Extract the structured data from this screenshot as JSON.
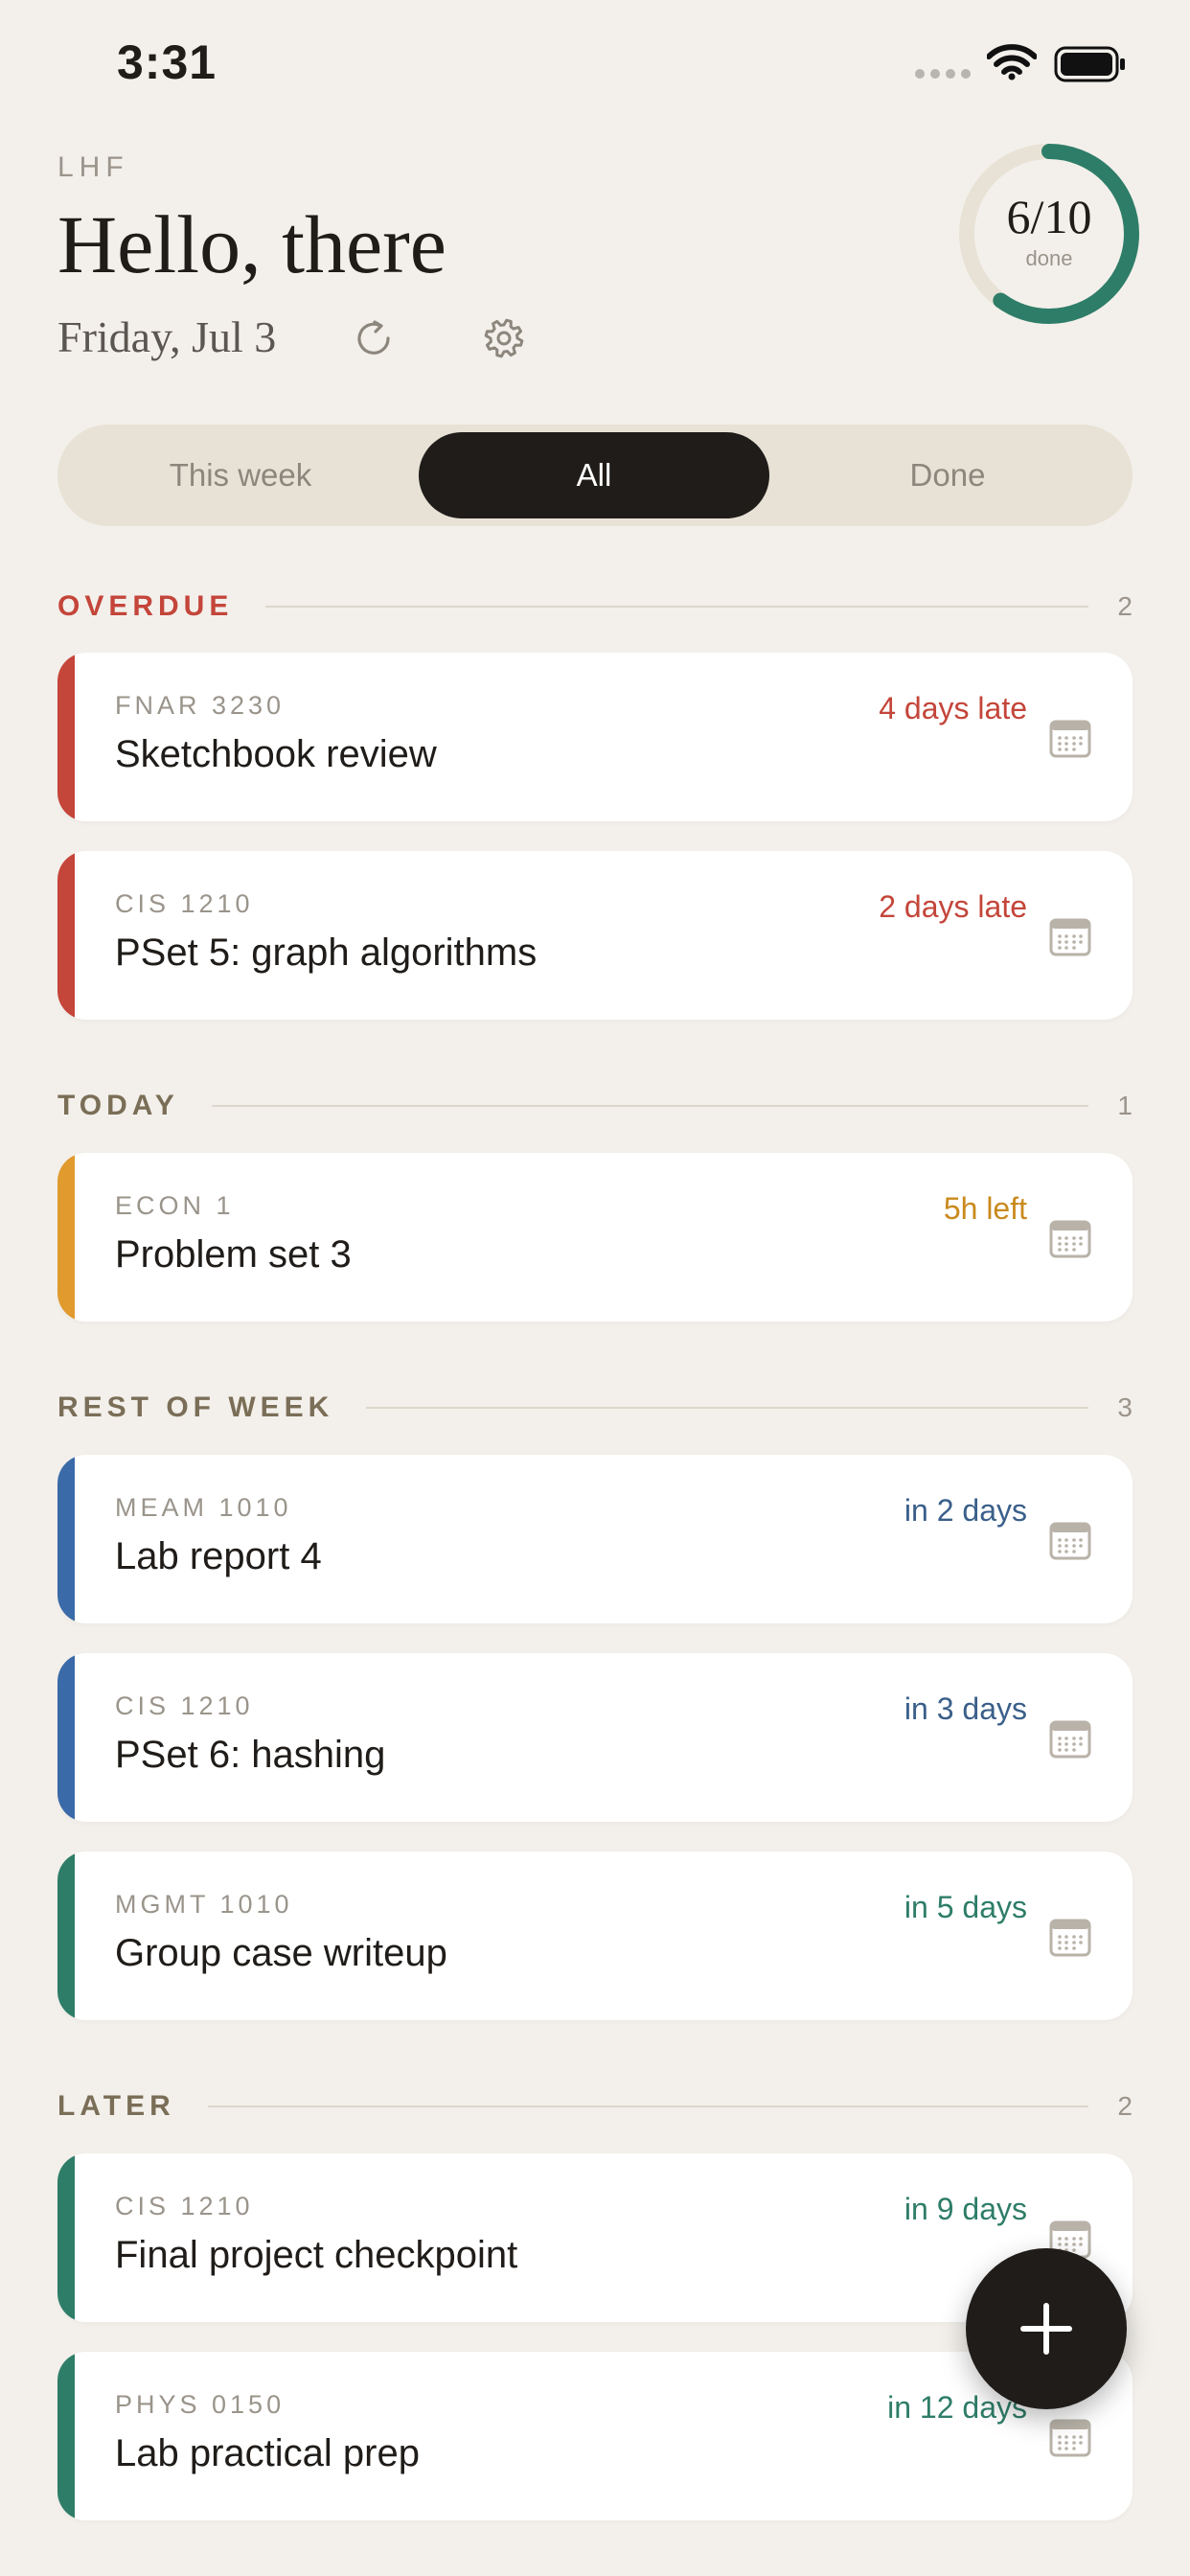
{
  "status_bar": {
    "time": "3:31"
  },
  "header": {
    "brand": "LHF",
    "greeting": "Hello, there",
    "date": "Friday, Jul 3"
  },
  "progress": {
    "count_label": "6/10",
    "done_label": "done",
    "done": 6,
    "total": 10
  },
  "tabs": [
    {
      "label": "This week"
    },
    {
      "label": "All",
      "selected": true
    },
    {
      "label": "Done"
    }
  ],
  "sections": {
    "overdue": {
      "title": "OVERDUE",
      "count": "2",
      "items": [
        {
          "course": "FNAR 3230",
          "title": "Sketchbook review",
          "due": "4 days late"
        },
        {
          "course": "CIS 1210",
          "title": "PSet 5: graph algorithms",
          "due": "2 days late"
        }
      ]
    },
    "today": {
      "title": "TODAY",
      "count": "1",
      "items": [
        {
          "course": "ECON 1",
          "title": "Problem set 3",
          "due": "5h left"
        }
      ]
    },
    "rest_of_week": {
      "title": "REST OF WEEK",
      "count": "3",
      "items": [
        {
          "course": "MEAM 1010",
          "title": "Lab report 4",
          "due": "in 2 days"
        },
        {
          "course": "CIS 1210",
          "title": "PSet 6: hashing",
          "due": "in 3 days"
        },
        {
          "course": "MGMT 1010",
          "title": "Group case writeup",
          "due": "in 5 days"
        }
      ]
    },
    "later": {
      "title": "LATER",
      "count": "2",
      "items": [
        {
          "course": "CIS 1210",
          "title": "Final project checkpoint",
          "due": "in 9 days"
        },
        {
          "course": "PHYS 0150",
          "title": "Lab practical prep",
          "due": "in 12 days"
        }
      ]
    }
  },
  "icons": {
    "refresh": "refresh-icon",
    "settings": "gear-icon",
    "calendar": "calendar-icon",
    "add": "plus-icon"
  },
  "colors": {
    "background": "#f3f0eb",
    "overdue": "#c4453a",
    "today": "#e09a2e",
    "today_text": "#c98a1e",
    "blue": "#3a6aa8",
    "blue_text": "#3a5f8a",
    "green": "#2e7d68",
    "green_text": "#2e7d68",
    "ring": "#2e7d68",
    "ring_track": "#e8e2d6",
    "dark": "#1f1c19"
  }
}
